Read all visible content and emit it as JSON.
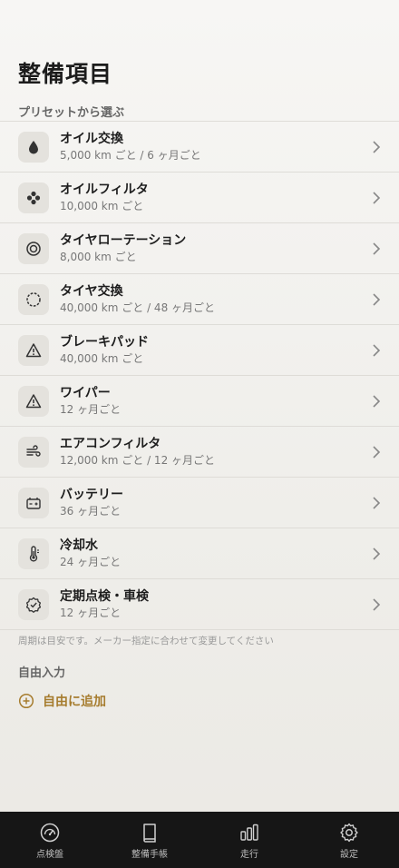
{
  "header": {
    "title": "整備項目"
  },
  "presets": {
    "label": "プリセットから選ぶ",
    "items": [
      {
        "title": "オイル交換",
        "sub": "5,000 km ごと / 6 ヶ月ごと",
        "icon": "oil-drop-icon"
      },
      {
        "title": "オイルフィルタ",
        "sub": "10,000 km ごと",
        "icon": "filter-icon"
      },
      {
        "title": "タイヤローテーション",
        "sub": "8,000 km ごと",
        "icon": "tire-rotation-icon"
      },
      {
        "title": "タイヤ交換",
        "sub": "40,000 km ごと / 48 ヶ月ごと",
        "icon": "tire-icon"
      },
      {
        "title": "ブレーキパッド",
        "sub": "40,000 km ごと",
        "icon": "warning-icon"
      },
      {
        "title": "ワイパー",
        "sub": "12 ヶ月ごと",
        "icon": "warning-icon"
      },
      {
        "title": "エアコンフィルタ",
        "sub": "12,000 km ごと / 12 ヶ月ごと",
        "icon": "wind-icon"
      },
      {
        "title": "バッテリー",
        "sub": "36 ヶ月ごと",
        "icon": "battery-icon"
      },
      {
        "title": "冷却水",
        "sub": "24 ヶ月ごと",
        "icon": "thermometer-icon"
      },
      {
        "title": "定期点検・車検",
        "sub": "12 ヶ月ごと",
        "icon": "badge-check-icon"
      }
    ]
  },
  "note": "周期は目安です。メーカー指定に合わせて変更してください",
  "custom": {
    "label": "自由入力",
    "add_label": "自由に追加"
  },
  "tabbar": {
    "tabs": [
      {
        "label": "点検盤",
        "icon": "gauge-icon"
      },
      {
        "label": "整備手帳",
        "icon": "book-icon"
      },
      {
        "label": "走行",
        "icon": "bar-chart-icon"
      },
      {
        "label": "設定",
        "icon": "gear-icon"
      }
    ]
  },
  "colors": {
    "accent": "#a67c2e",
    "tabbar_bg": "#161616"
  }
}
